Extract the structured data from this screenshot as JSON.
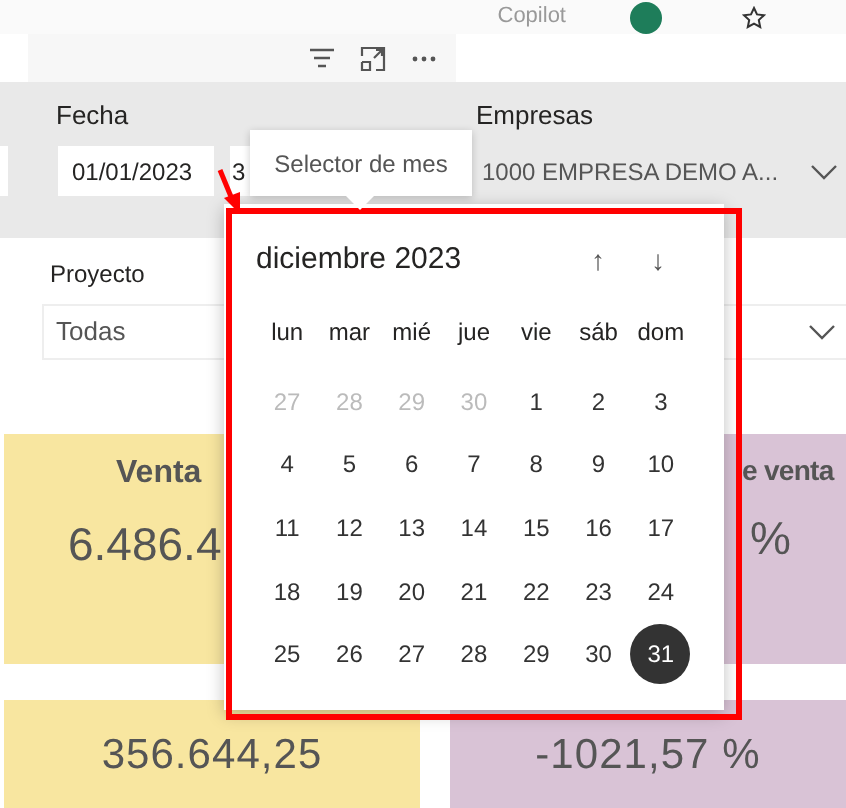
{
  "header": {
    "copilot": "Copilot"
  },
  "filters": {
    "fecha": {
      "label": "Fecha",
      "start_value": "01/01/2023",
      "end_value": "3"
    },
    "empresas": {
      "label": "Empresas",
      "value": "1000 EMPRESA DEMO A..."
    },
    "proyecto": {
      "label": "Proyecto",
      "value": "Todas"
    }
  },
  "tooltip": "Selector de mes",
  "cards": [
    {
      "title": "Venta",
      "value": "6.486.4",
      "color": "#f8e6a0"
    },
    {
      "title": "e venta",
      "value": "%",
      "color": "#d9c3d6"
    }
  ],
  "lower_cards": [
    {
      "value": "356.644,25",
      "color": "#f8e6a0"
    },
    {
      "value": "-1021,57 %",
      "color": "#d9c3d6"
    }
  ],
  "calendar": {
    "month": "diciembre 2023",
    "up": "↑",
    "down": "↓",
    "weekdays": [
      "lun",
      "mar",
      "mié",
      "jue",
      "vie",
      "sáb",
      "dom"
    ],
    "weeks": [
      [
        {
          "day": "27",
          "muted": true,
          "selected": false
        },
        {
          "day": "28",
          "muted": true,
          "selected": false
        },
        {
          "day": "29",
          "muted": true,
          "selected": false
        },
        {
          "day": "30",
          "muted": true,
          "selected": false
        },
        {
          "day": "1",
          "muted": false,
          "selected": false
        },
        {
          "day": "2",
          "muted": false,
          "selected": false
        },
        {
          "day": "3",
          "muted": false,
          "selected": false
        }
      ],
      [
        {
          "day": "4",
          "muted": false,
          "selected": false
        },
        {
          "day": "5",
          "muted": false,
          "selected": false
        },
        {
          "day": "6",
          "muted": false,
          "selected": false
        },
        {
          "day": "7",
          "muted": false,
          "selected": false
        },
        {
          "day": "8",
          "muted": false,
          "selected": false
        },
        {
          "day": "9",
          "muted": false,
          "selected": false
        },
        {
          "day": "10",
          "muted": false,
          "selected": false
        }
      ],
      [
        {
          "day": "11",
          "muted": false,
          "selected": false
        },
        {
          "day": "12",
          "muted": false,
          "selected": false
        },
        {
          "day": "13",
          "muted": false,
          "selected": false
        },
        {
          "day": "14",
          "muted": false,
          "selected": false
        },
        {
          "day": "15",
          "muted": false,
          "selected": false
        },
        {
          "day": "16",
          "muted": false,
          "selected": false
        },
        {
          "day": "17",
          "muted": false,
          "selected": false
        }
      ],
      [
        {
          "day": "18",
          "muted": false,
          "selected": false
        },
        {
          "day": "19",
          "muted": false,
          "selected": false
        },
        {
          "day": "20",
          "muted": false,
          "selected": false
        },
        {
          "day": "21",
          "muted": false,
          "selected": false
        },
        {
          "day": "22",
          "muted": false,
          "selected": false
        },
        {
          "day": "23",
          "muted": false,
          "selected": false
        },
        {
          "day": "24",
          "muted": false,
          "selected": false
        }
      ],
      [
        {
          "day": "25",
          "muted": false,
          "selected": false
        },
        {
          "day": "26",
          "muted": false,
          "selected": false
        },
        {
          "day": "27",
          "muted": false,
          "selected": false
        },
        {
          "day": "28",
          "muted": false,
          "selected": false
        },
        {
          "day": "29",
          "muted": false,
          "selected": false
        },
        {
          "day": "30",
          "muted": false,
          "selected": false
        },
        {
          "day": "31",
          "muted": false,
          "selected": true
        }
      ]
    ]
  }
}
